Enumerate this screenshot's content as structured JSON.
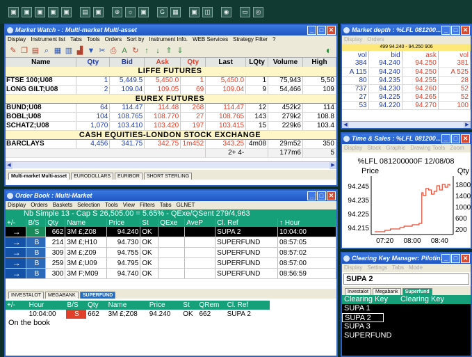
{
  "toolbar": {
    "buttons": [
      "▣",
      "▣",
      "▣",
      "▣",
      "▣",
      "▤",
      "▣",
      "⊕",
      "☼",
      "▣",
      "G",
      "▦",
      "▣",
      "◫",
      "◉",
      "▭",
      "◎"
    ]
  },
  "market_watch": {
    "title": "Market Watch - : Multi-market Multi-asset",
    "menu": [
      "Display",
      "Instrument list",
      "Tabs",
      "Tools",
      "Orders",
      "Sort by",
      "Instrument Info.",
      "WEB Services",
      "Strategy Filter",
      "?"
    ],
    "columns": [
      "Name",
      "Qty",
      "Bid",
      "Ask",
      "Qty",
      "Last",
      "LQty",
      "Volume",
      "High"
    ],
    "sections": [
      {
        "title": "LIFFE FUTURES",
        "rows": [
          [
            "FTSE 100;U08",
            "1",
            "5,449.5",
            "5,450.0",
            "1",
            "5,450.0",
            "1",
            "75,943",
            "5,50"
          ],
          [
            "LONG GILT;U08",
            "2",
            "109.04",
            "109.05",
            "69",
            "109.04",
            "9",
            "54,466",
            "109"
          ]
        ]
      },
      {
        "title": "EUREX FUTURES",
        "rows": [
          [
            "BUND;U08",
            "64",
            "114.47",
            "114.48",
            "268",
            "114.47",
            "12",
            "452k2",
            "114"
          ],
          [
            "BOBL;U08",
            "104",
            "108.765",
            "108.770",
            "27",
            "108.765",
            "143",
            "279k2",
            "108.8"
          ],
          [
            "SCHATZ;U08",
            "1,070",
            "103.410",
            "103.420",
            "197",
            "103.415",
            "15",
            "229k6",
            "103.4"
          ]
        ]
      },
      {
        "title": "CASH EQUITIES-LONDON STOCK EXCHANGE",
        "rows": [
          [
            "BARCLAYS",
            "4,456",
            "341.75",
            "342.75",
            "1m452",
            "343.25",
            "4m08",
            "29m52",
            "350"
          ]
        ]
      }
    ],
    "footer_row": [
      "2+ 4-",
      "177m6",
      "5"
    ],
    "tabs": [
      "Multi-market Multi-asset",
      "EURODOLLARS",
      "EURIBOR",
      "SHORT STERLING"
    ]
  },
  "market_depth": {
    "title": "Market depth : %LFL 081200...",
    "menu": [
      "Display",
      "Orders"
    ],
    "header_info": "499 94.240 - 94.250 906",
    "columns": [
      "vol",
      "bid",
      "ask",
      "vol"
    ],
    "rows": [
      [
        "384",
        "94.240",
        "94.250",
        "381"
      ],
      [
        "A 115",
        "94.240",
        "94.250",
        "A 525"
      ],
      [
        "80",
        "94.235",
        "94.255",
        "28"
      ],
      [
        "737",
        "94.230",
        "94.260",
        "52"
      ],
      [
        "27",
        "94.225",
        "94.265",
        "52"
      ],
      [
        "53",
        "94.220",
        "94.270",
        "100"
      ]
    ]
  },
  "time_sales": {
    "title": "Time & Sales : %LFL 081200...",
    "menu": [
      "Display",
      "Stock",
      "Graphic",
      "Drawing Tools",
      "Zoom"
    ],
    "chart_title": "%LFL 081200000F 12/08/08",
    "ylabel_left": "Price",
    "ylabel_right": "Qty"
  },
  "chart_data": {
    "type": "line",
    "title": "%LFL 081200000F 12/08/08",
    "xlabel": "",
    "ylabel": "Price",
    "x_ticks": [
      "07:20",
      "08:00",
      "08:40"
    ],
    "y_ticks_left": [
      "94.245",
      "94.235",
      "94.225",
      "94.215"
    ],
    "y_ticks_right": [
      "1800",
      "1400",
      "1000",
      "600",
      "200"
    ],
    "ylim": [
      94.21,
      94.25
    ],
    "series": [
      {
        "x": [
          "07:05",
          "07:12",
          "07:20",
          "07:28",
          "07:35",
          "07:42",
          "07:48",
          "07:55",
          "08:00",
          "08:05",
          "08:10",
          "08:14",
          "08:16",
          "08:20",
          "08:24",
          "08:28",
          "08:32",
          "08:36",
          "08:40",
          "08:44",
          "08:48",
          "08:52",
          "08:55"
        ],
        "values": [
          94.212,
          94.212,
          94.213,
          94.214,
          94.214,
          94.215,
          94.216,
          94.216,
          94.217,
          94.217,
          94.218,
          94.24,
          94.238,
          94.243,
          94.242,
          94.239,
          94.241,
          94.245,
          94.242,
          94.246,
          94.244,
          94.246,
          94.245
        ]
      }
    ],
    "grid": false,
    "colors": {
      "line": "#e24a33",
      "text": "#000000"
    }
  },
  "order_book": {
    "title": "Order Book : Multi-Market",
    "menu": [
      "Display",
      "Orders",
      "Baskets",
      "Selection",
      "Tools",
      "View",
      "Filters",
      "Tabs",
      "GLNET"
    ],
    "summary": "Nb Simple   13 - Cap   S 26,505.00 = 5.65%  - QExe/QSent  279/4,963",
    "columns": [
      "+/-",
      "B/S",
      "Qty",
      "Name",
      "Price",
      "St",
      "QExe",
      "AveP",
      "Cl. Ref",
      "↑ Hour"
    ],
    "rows": [
      [
        "→",
        "S",
        "662",
        "3M £;Z08",
        "94.240",
        "OK",
        "",
        "",
        "SUPA 2",
        "10:04:00"
      ],
      [
        "→",
        "B",
        "214",
        "3M £;H10",
        "94.730",
        "OK",
        "",
        "",
        "SUPERFUND",
        "08:57:05"
      ],
      [
        "→",
        "B",
        "309",
        "3M £;Z09",
        "94.755",
        "OK",
        "",
        "",
        "SUPERFUND",
        "08:57:02"
      ],
      [
        "→",
        "B",
        "259",
        "3M £;U09",
        "94.795",
        "OK",
        "",
        "",
        "SUPERFUND",
        "08:57:00"
      ],
      [
        "→",
        "B",
        "300",
        "3M F;M09",
        "94.740",
        "OK",
        "",
        "",
        "SUPERFUND",
        "08:56:59"
      ]
    ],
    "tabs": [
      "INVESTALOT",
      "MEGABANK",
      "SUPERFUND"
    ]
  },
  "fills": {
    "columns": [
      "+/-",
      "Hour",
      "B/S",
      "Qty",
      "Name",
      "Price",
      "St",
      "QRem",
      "Cl. Ref"
    ],
    "row": [
      "",
      "10:04:00",
      "S",
      "662",
      "3M £;Z08",
      "94.240",
      "OK",
      "662",
      "SUPA 2"
    ],
    "status": "On the book"
  },
  "clearing_key": {
    "title": "Clearing Key Manager: Pilotin...",
    "menu": [
      "Display",
      "Settings",
      "Tabs",
      "Mode"
    ],
    "input_value": "SUPA 2",
    "tabs": [
      "Investalot",
      "Megabank",
      "Superfund"
    ],
    "header": [
      "Clearing Key",
      "Clearing Key"
    ],
    "items": [
      "SUPA 1",
      "SUPA 2",
      "SUPA 3",
      "SUPERFUND"
    ]
  }
}
